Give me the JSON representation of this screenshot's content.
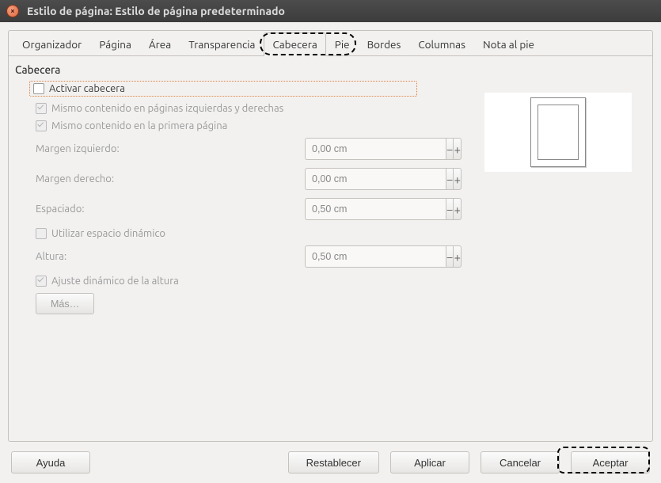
{
  "title": "Estilo de página: Estilo de página predeterminado",
  "tabs": {
    "organizador": "Organizador",
    "pagina": "Página",
    "area": "Área",
    "transparencia": "Transparencia",
    "cabecera": "Cabecera",
    "pie": "Pie",
    "bordes": "Bordes",
    "columnas": "Columnas",
    "nota": "Nota al pie"
  },
  "section": {
    "title": "Cabecera",
    "activate": "Activar cabecera",
    "same_lr": "Mismo contenido en páginas izquierdas y derechas",
    "same_first": "Mismo contenido en la primera página",
    "margin_left": {
      "label": "Margen izquierdo:",
      "value": "0,00 cm"
    },
    "margin_right": {
      "label": "Margen derecho:",
      "value": "0,00 cm"
    },
    "spacing": {
      "label": "Espaciado:",
      "value": "0,50 cm"
    },
    "dyn_space": "Utilizar espacio dinámico",
    "height": {
      "label": "Altura:",
      "value": "0,50 cm"
    },
    "dyn_height": "Ajuste dinámico de la altura",
    "more": "Más…"
  },
  "footer": {
    "help": "Ayuda",
    "reset": "Restablecer",
    "apply": "Aplicar",
    "cancel": "Cancelar",
    "accept": "Aceptar"
  }
}
